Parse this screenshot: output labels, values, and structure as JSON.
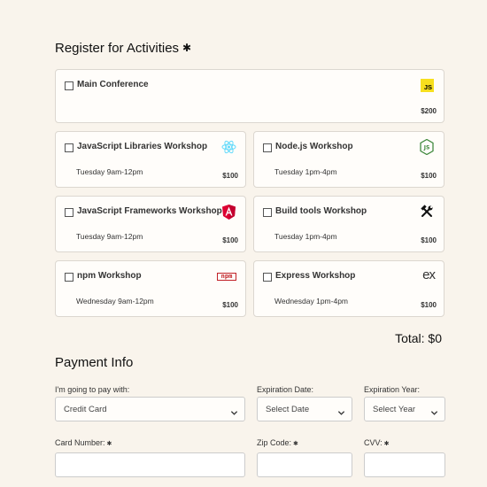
{
  "activities": {
    "heading": "Register for Activities",
    "required_marker": "✱",
    "items": [
      {
        "title": "Main Conference",
        "time": "",
        "price": "$200",
        "logo": "js-icon",
        "logo_text": "JS"
      },
      {
        "title": "JavaScript Libraries Workshop",
        "time": "Tuesday 9am-12pm",
        "price": "$100",
        "logo": "react-icon"
      },
      {
        "title": "Node.js Workshop",
        "time": "Tuesday 1pm-4pm",
        "price": "$100",
        "logo": "nodejs-icon"
      },
      {
        "title": "JavaScript Frameworks Workshop",
        "time": "Tuesday 9am-12pm",
        "price": "$100",
        "logo": "angular-icon"
      },
      {
        "title": "Build tools Workshop",
        "time": "Tuesday 1pm-4pm",
        "price": "$100",
        "logo": "build-tools-icon"
      },
      {
        "title": "npm Workshop",
        "time": "Wednesday 9am-12pm",
        "price": "$100",
        "logo": "npm-icon",
        "logo_text": "npm"
      },
      {
        "title": "Express Workshop",
        "time": "Wednesday 1pm-4pm",
        "price": "$100",
        "logo": "express-icon",
        "logo_text": "ex"
      }
    ],
    "total": "Total: $0"
  },
  "payment": {
    "heading": "Payment Info",
    "pay_with_label": "I'm going to pay with:",
    "pay_with_value": "Credit Card",
    "exp_date_label": "Expiration Date:",
    "exp_date_value": "Select Date",
    "exp_year_label": "Expiration Year:",
    "exp_year_value": "Select Year",
    "card_number_label": "Card Number:",
    "zip_label": "Zip Code:",
    "cvv_label": "CVV:",
    "field_required_marker": "✱"
  },
  "colors": {
    "background": "#f9f4ec",
    "card_background": "#fffdfa",
    "js_yellow": "#f7df1e",
    "react_blue": "#61dafb",
    "node_green": "#3c873a",
    "angular_red": "#dd0031",
    "npm_red": "#c12127"
  }
}
